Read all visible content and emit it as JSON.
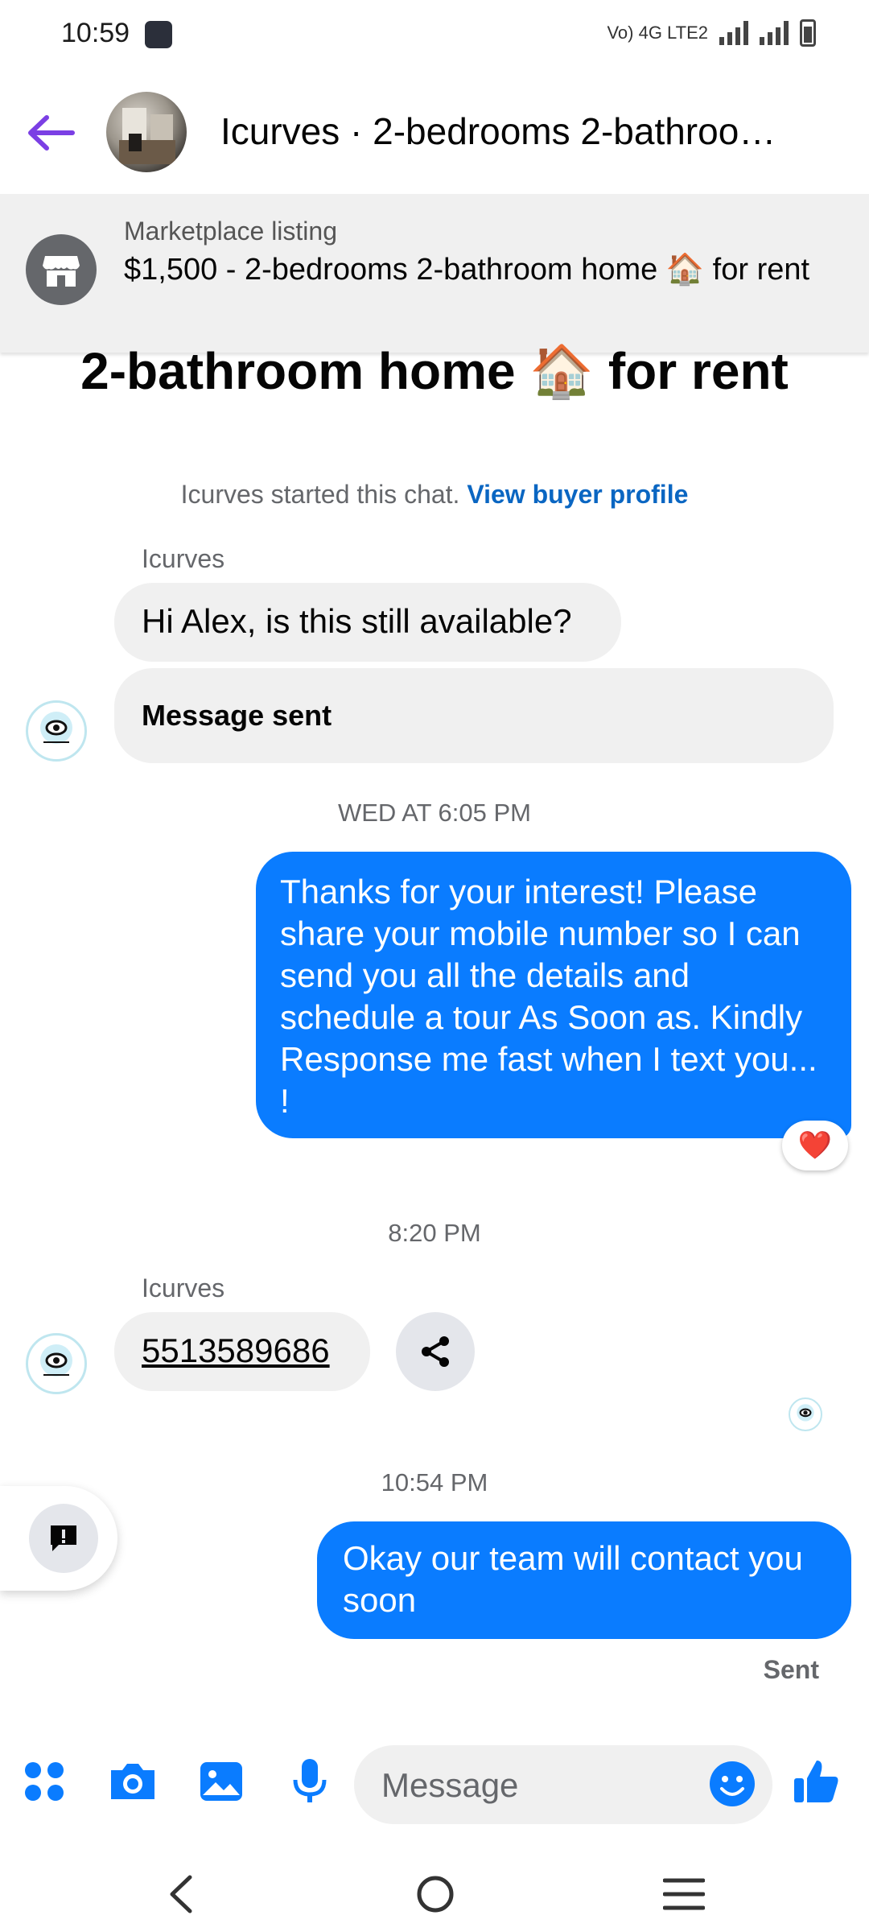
{
  "status_bar": {
    "time": "10:59",
    "network": "Vo) 4G LTE2"
  },
  "header": {
    "title": "Icurves · 2-bedrooms 2-bathroo…"
  },
  "listing": {
    "label": "Marketplace listing",
    "title": "$1,500 - 2-bedrooms 2-bathroom home 🏠 for rent"
  },
  "banner_heading": "2-bathroom home 🏠 for rent",
  "system_line": {
    "text": "Icurves started this chat.",
    "link": "View buyer profile"
  },
  "messages": {
    "sender1": "Icurves",
    "incoming1": "Hi Alex, is this still available?",
    "incoming1_status": "Message sent",
    "time1": "WED AT 6:05 PM",
    "outgoing1": "Thanks for your interest! Please share your mobile number so I can send you all the details and schedule a tour As Soon as. Kindly Response me fast when I text you... !",
    "reaction": "❤️",
    "time2": "8:20 PM",
    "sender2": "Icurves",
    "incoming2": "5513589686",
    "time3": "10:54 PM",
    "outgoing2": "Okay our team will contact you soon",
    "sent_status": "Sent"
  },
  "composer": {
    "placeholder": "Message",
    "icons": [
      "apps-icon",
      "camera-icon",
      "gallery-icon",
      "mic-icon",
      "emoji-icon",
      "like-icon"
    ]
  },
  "colors": {
    "accent": "#0a7cff",
    "back_arrow": "#7b3fe4",
    "link": "#0a66c2"
  }
}
